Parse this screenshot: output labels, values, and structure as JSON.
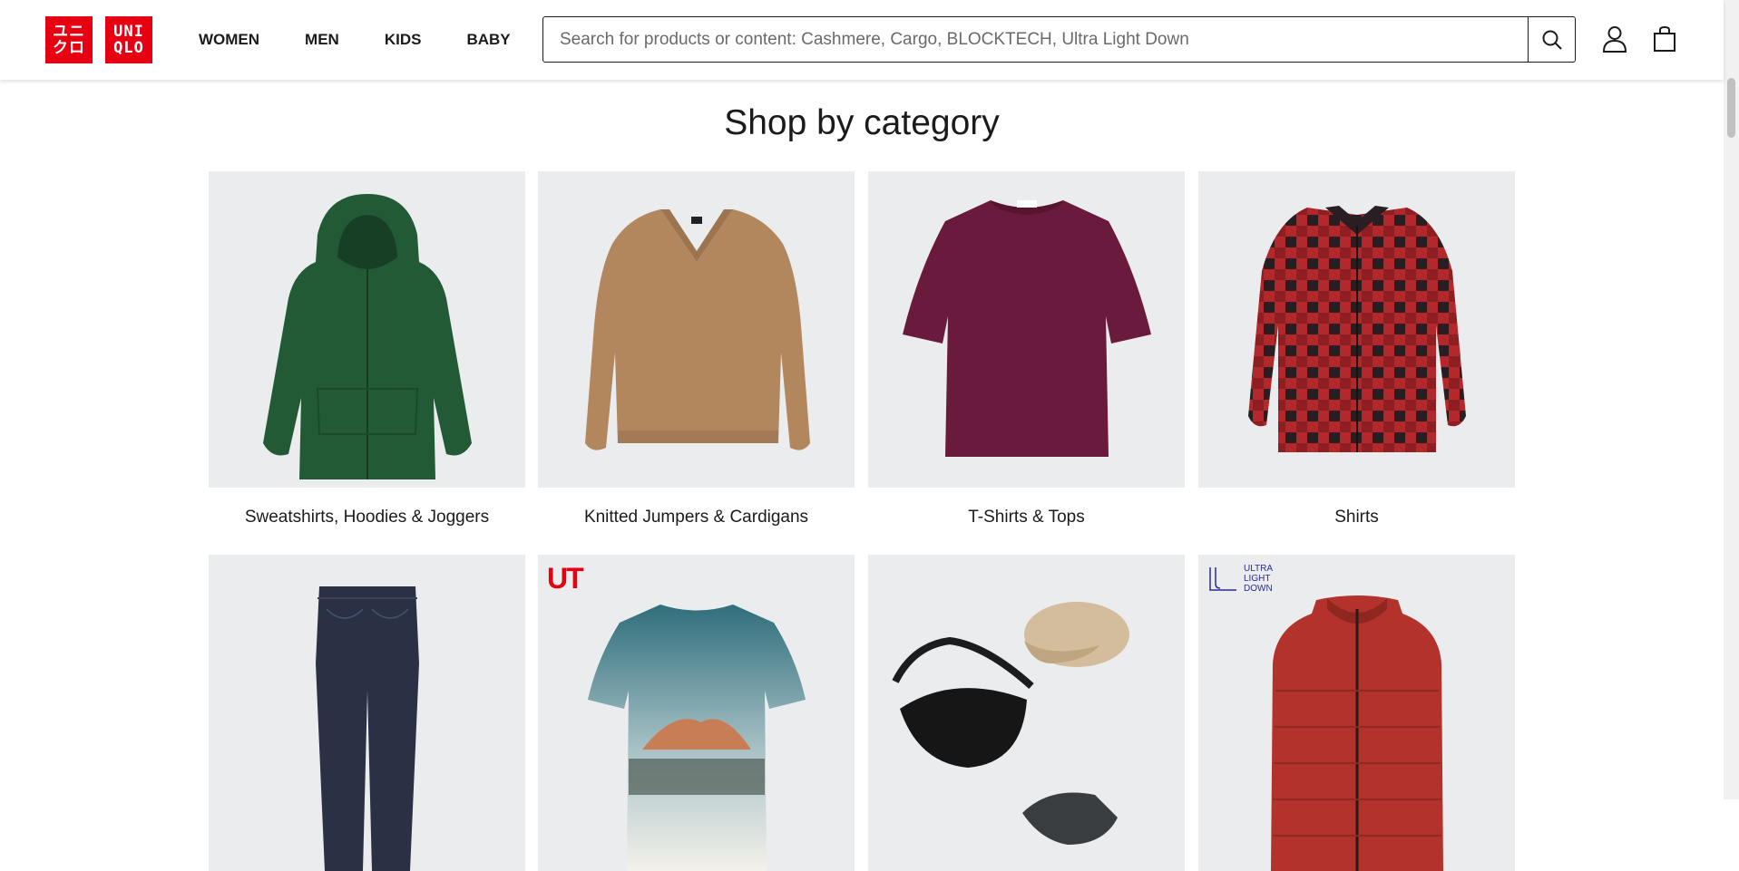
{
  "brand": {
    "logo_text_left": [
      "ユニ",
      "クロ"
    ],
    "logo_text_right": [
      "UNI",
      "QLO"
    ],
    "color": "#e60012"
  },
  "nav": [
    "WOMEN",
    "MEN",
    "KIDS",
    "BABY"
  ],
  "search": {
    "placeholder": "Search for products or content: Cashmere, Cargo, BLOCKTECH, Ultra Light Down",
    "value": ""
  },
  "icons": {
    "search": "search-icon",
    "account": "user-icon",
    "cart": "shopping-bag-icon"
  },
  "section": {
    "title": "Shop by category"
  },
  "categories": [
    {
      "label": "Sweatshirts, Hoodies & Joggers",
      "image": "green-hoodie"
    },
    {
      "label": "Knitted Jumpers & Cardigans",
      "image": "tan-vneck-jumper"
    },
    {
      "label": "T-Shirts & Tops",
      "image": "burgundy-tshirt"
    },
    {
      "label": "Shirts",
      "image": "red-check-flannel-shirt"
    },
    {
      "label": "",
      "image": "navy-jeans"
    },
    {
      "label": "",
      "image": "ut-graphic-tshirt",
      "badge": "UT"
    },
    {
      "label": "",
      "image": "accessories-bag-cap-sunglasses"
    },
    {
      "label": "",
      "image": "red-down-vest",
      "badge_lines": [
        "ULTRA",
        "LIGHT",
        "DOWN"
      ]
    }
  ]
}
